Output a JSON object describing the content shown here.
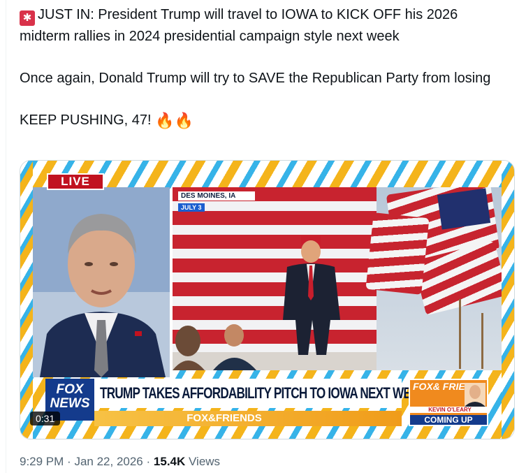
{
  "tweet": {
    "line1": "JUST IN: President Trump will travel to IOWA to KICK OFF his 2026 midterm rallies in 2024 presidential campaign style next week",
    "line2": "Once again, Donald Trump will try to SAVE the Republican Party from losing",
    "line3": "KEEP PUSHING, 47!",
    "siren_icon": "rotating-light-icon",
    "fire_icon": "fire-icon"
  },
  "media": {
    "live_label": "LIVE",
    "location": "DES MOINES, IA",
    "date_tag": "JULY 3",
    "chyron": "TRUMP TAKES AFFORDABILITY PITCH TO IOWA NEXT WEEK",
    "network_logo": "FOX NEWS",
    "show_name": "FOX&FRIENDS",
    "promo_logo": "FOX& FRIENDS",
    "promo_name": "KEVIN O'LEARY",
    "promo_coming": "COMING UP",
    "duration": "0:31"
  },
  "meta": {
    "time": "9:29 PM",
    "date": "Jan 22, 2026",
    "views_count": "15.4K",
    "views_label": "Views",
    "separator": "·"
  },
  "colors": {
    "text": "#0f1419",
    "muted": "#536471",
    "live_red": "#c1121f",
    "fox_blue": "#143b8c"
  }
}
